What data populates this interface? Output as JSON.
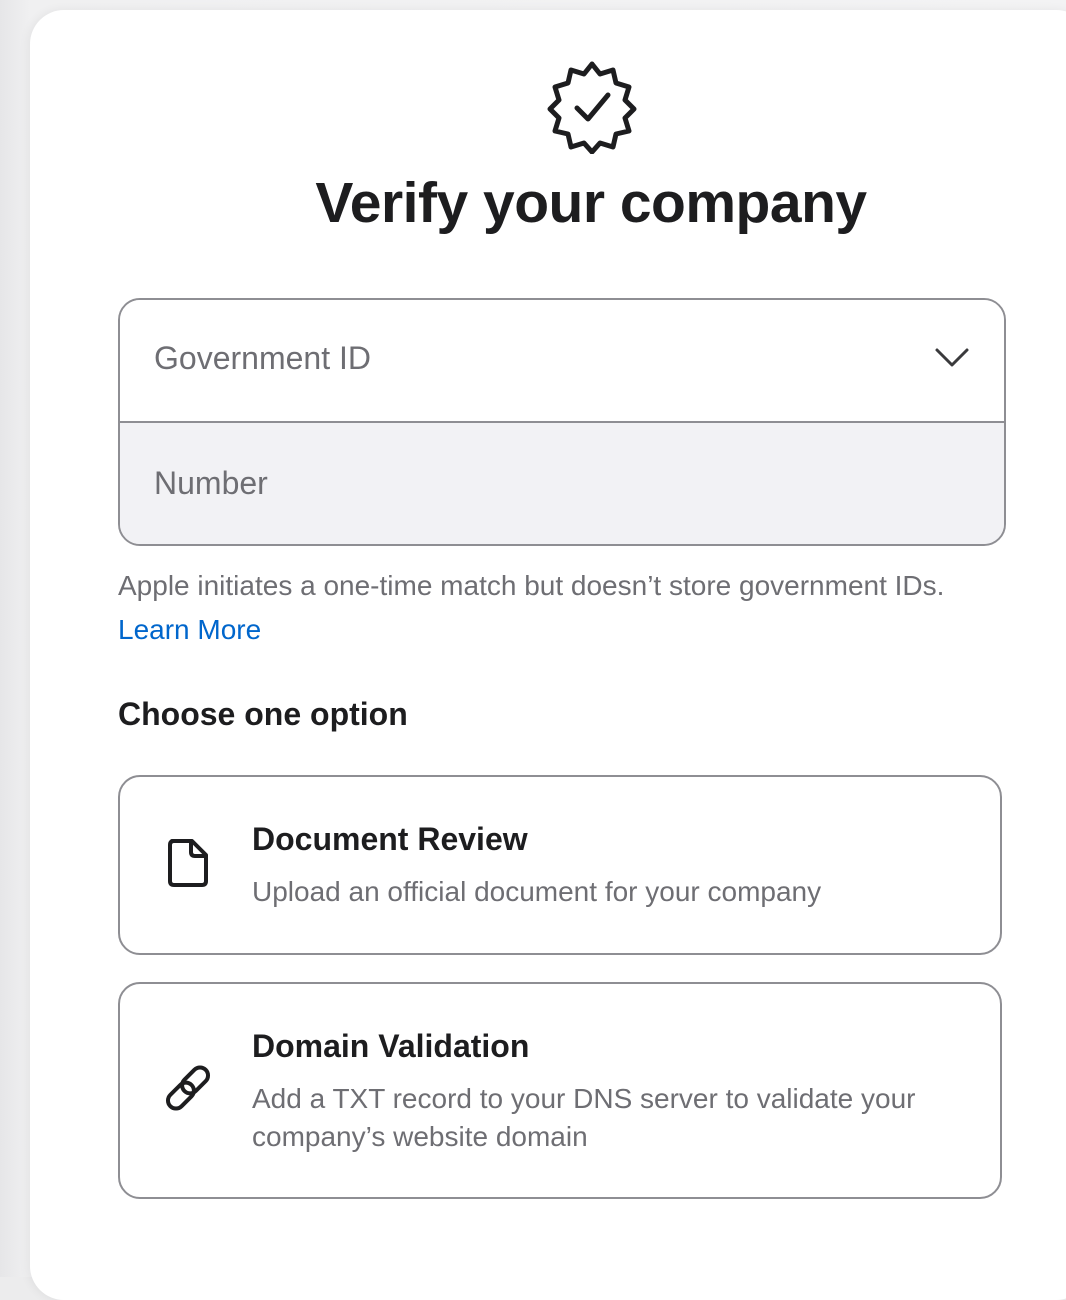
{
  "header": {
    "title": "Verify your company"
  },
  "id_form": {
    "id_type_select": {
      "selected": "Government ID",
      "options": [
        "Government ID"
      ]
    },
    "number_input": {
      "value": "",
      "placeholder": "Number"
    },
    "helper_text": "Apple initiates a one-time match but doesn’t store government IDs.",
    "learn_more_label": "Learn More"
  },
  "options_section": {
    "heading": "Choose one option",
    "options": [
      {
        "icon": "document-icon",
        "title": "Document Review",
        "description": "Upload an official document for your company"
      },
      {
        "icon": "link-icon",
        "title": "Domain Validation",
        "description": "Add a TXT record to your DNS server to validate your company’s website domain"
      }
    ]
  },
  "colors": {
    "text_primary": "#1d1d1f",
    "text_secondary": "#6e6e73",
    "link": "#0066cc",
    "border": "#8e8e93",
    "input_fill": "#f2f2f5",
    "card_background": "#ffffff"
  }
}
